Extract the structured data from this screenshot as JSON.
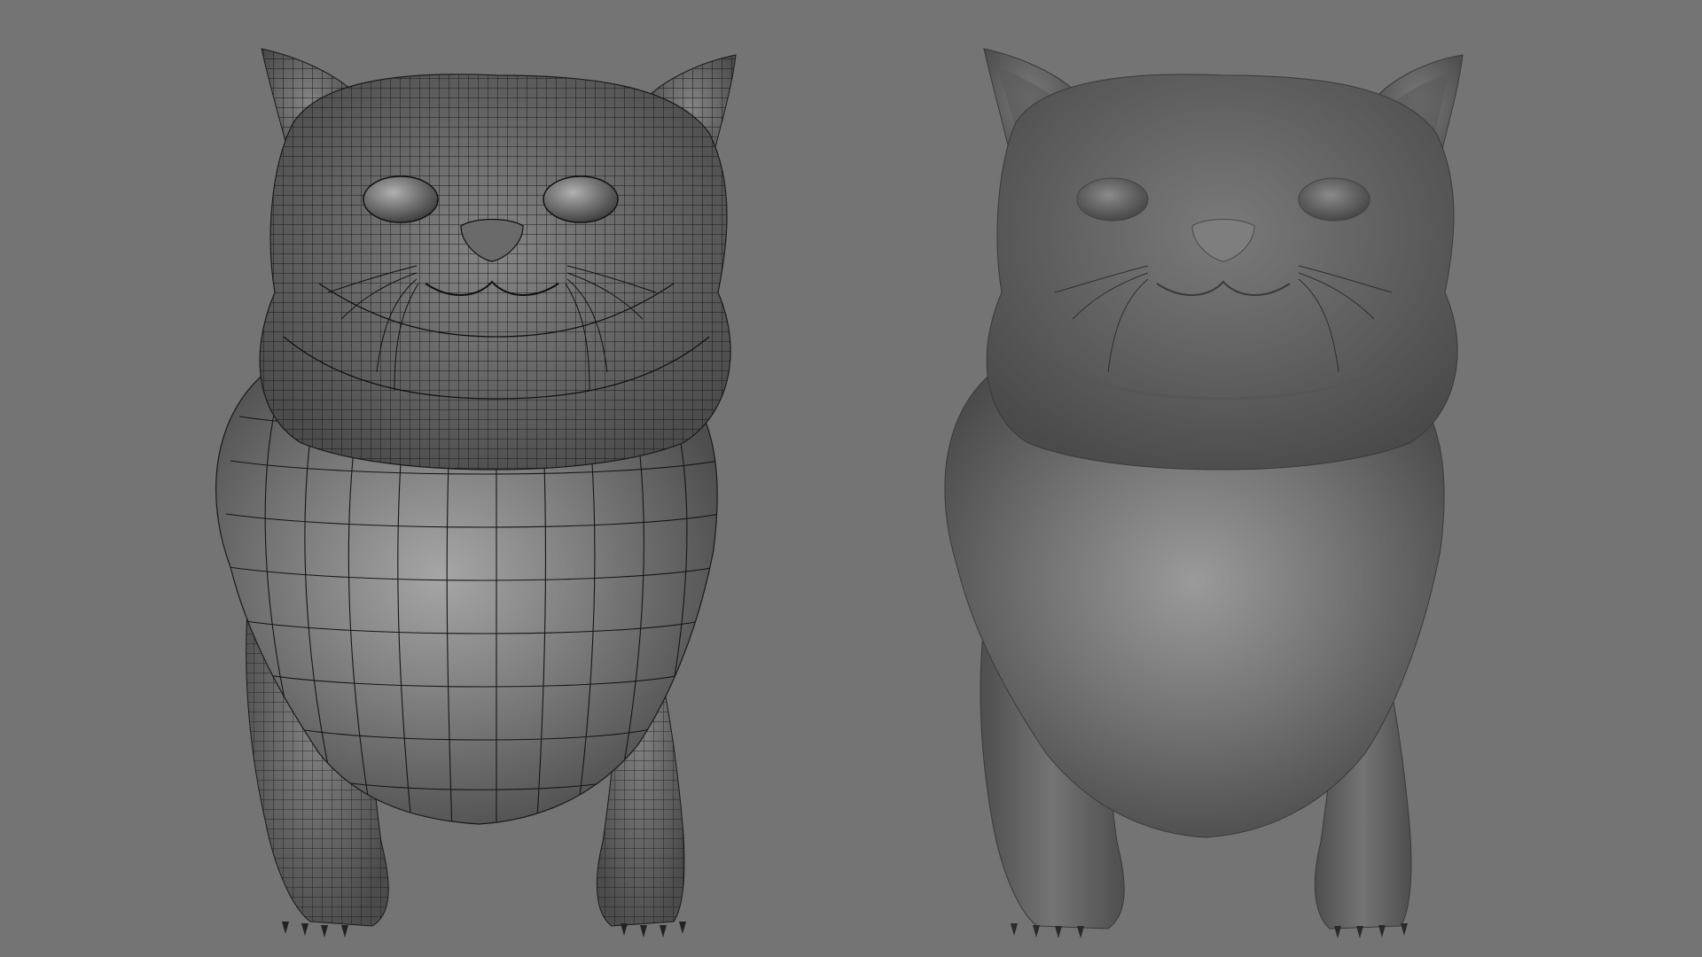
{
  "viewport": {
    "background_color": "#747474",
    "models": [
      {
        "name": "cat-model-wireframe",
        "shading": "wireframe-on-shaded",
        "body_color": "#7a7a7a",
        "wire_color": "#1a1a1a"
      },
      {
        "name": "cat-model-smooth",
        "shading": "smooth-shaded",
        "body_color": "#6e6e6e"
      }
    ]
  }
}
